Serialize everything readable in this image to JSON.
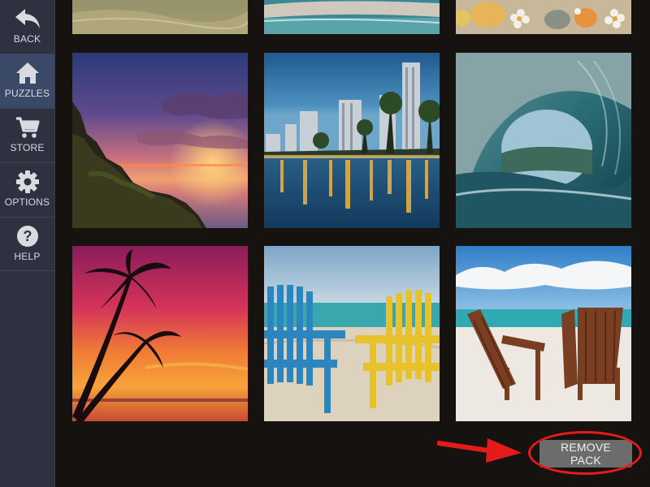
{
  "sidebar": {
    "items": [
      {
        "label": "BACK",
        "icon": "back-arrow-icon"
      },
      {
        "label": "PUZZLES",
        "icon": "home-icon"
      },
      {
        "label": "STORE",
        "icon": "cart-icon"
      },
      {
        "label": "OPTIONS",
        "icon": "gear-icon"
      },
      {
        "label": "HELP",
        "icon": "question-icon"
      }
    ],
    "active_index": 1
  },
  "puzzles": [
    {
      "scene": "beach-shallow-water"
    },
    {
      "scene": "beach-shoreline"
    },
    {
      "scene": "seashells-flowers"
    },
    {
      "scene": "cliff-sunset"
    },
    {
      "scene": "city-waterfront-night"
    },
    {
      "scene": "ocean-wave-tube"
    },
    {
      "scene": "palm-tree-sunset"
    },
    {
      "scene": "beach-chairs-blue-yellow"
    },
    {
      "scene": "beach-chairs-wooden"
    }
  ],
  "actions": {
    "remove_pack_label": "REMOVE PACK"
  },
  "colors": {
    "sidebar_bg": "#2d3140",
    "sidebar_active": "#3a4a66",
    "page_bg": "#151210",
    "button_bg": "#6c6c6c",
    "annotation_red": "#e51b1b"
  }
}
